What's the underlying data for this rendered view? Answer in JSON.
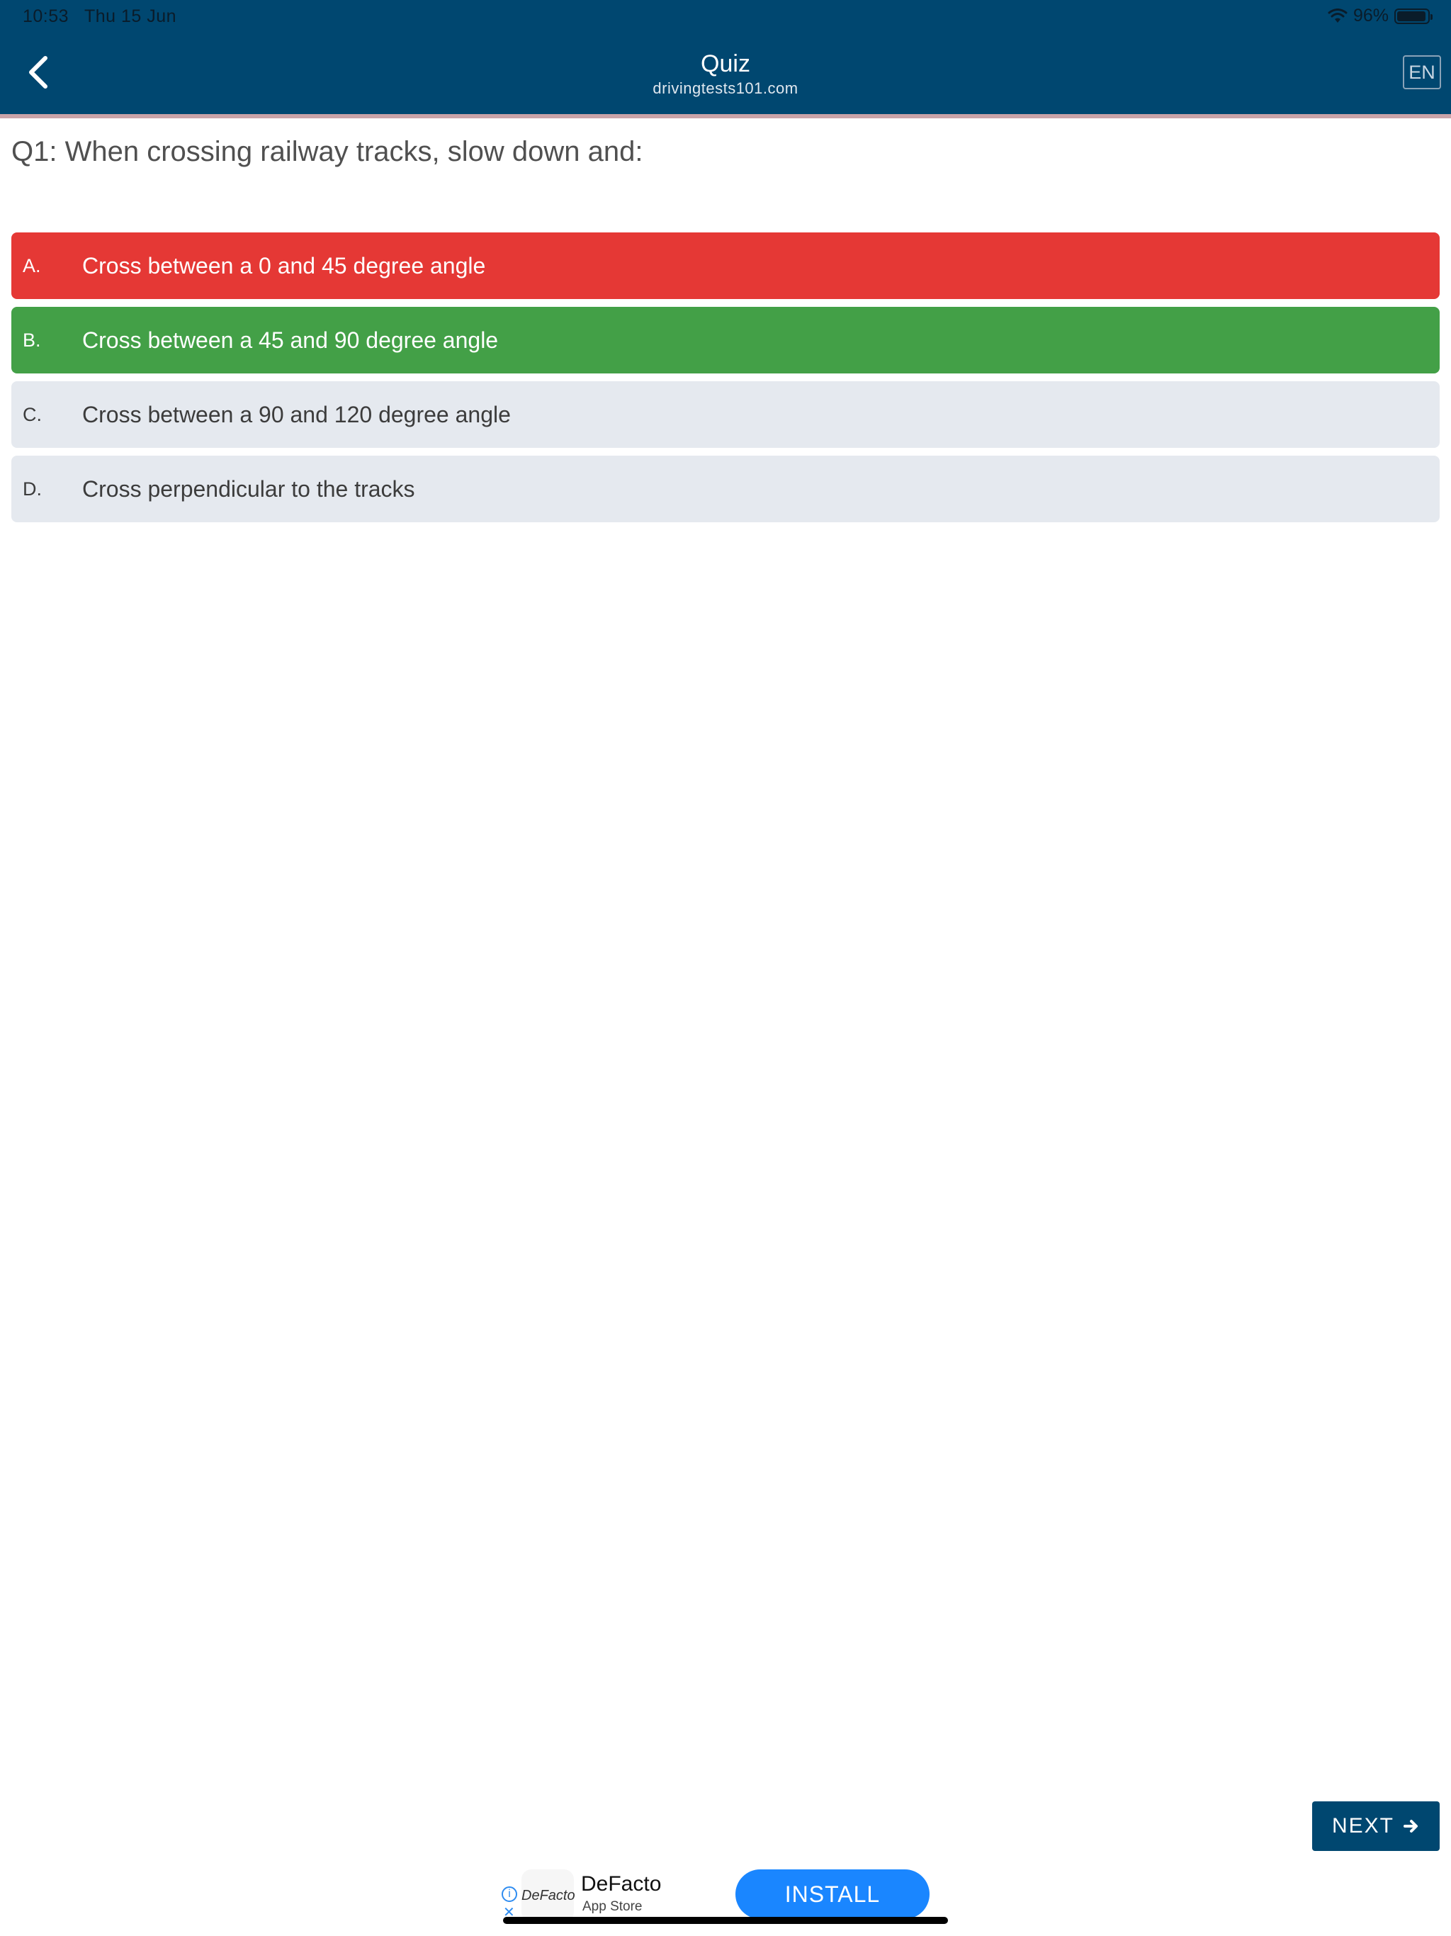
{
  "status_bar": {
    "time": "10:53",
    "date": "Thu 15 Jun",
    "battery": "96%",
    "battery_level": 0.96
  },
  "header": {
    "title": "Quiz",
    "subtitle": "drivingtests101.com",
    "language": "EN",
    "background_color": "#004770"
  },
  "question": {
    "text": "Q1: When crossing railway tracks, slow down and:"
  },
  "answers": [
    {
      "letter": "A.",
      "text": "Cross between a 0 and 45 degree angle",
      "state": "wrong"
    },
    {
      "letter": "B.",
      "text": "Cross between a 45 and 90 degree angle",
      "state": "correct"
    },
    {
      "letter": "C.",
      "text": "Cross between a 90 and 120 degree angle",
      "state": "neutral"
    },
    {
      "letter": "D.",
      "text": "Cross perpendicular to the tracks",
      "state": "neutral"
    }
  ],
  "colors": {
    "wrong": "#e53835",
    "correct": "#43a047",
    "neutral": "#e5e9ef"
  },
  "next_button": {
    "label": "NEXT",
    "icon": "arrow-right-icon"
  },
  "ad": {
    "logo_text": "DeFacto",
    "app_name": "DeFacto",
    "store": "App Store",
    "install_label": "INSTALL"
  }
}
